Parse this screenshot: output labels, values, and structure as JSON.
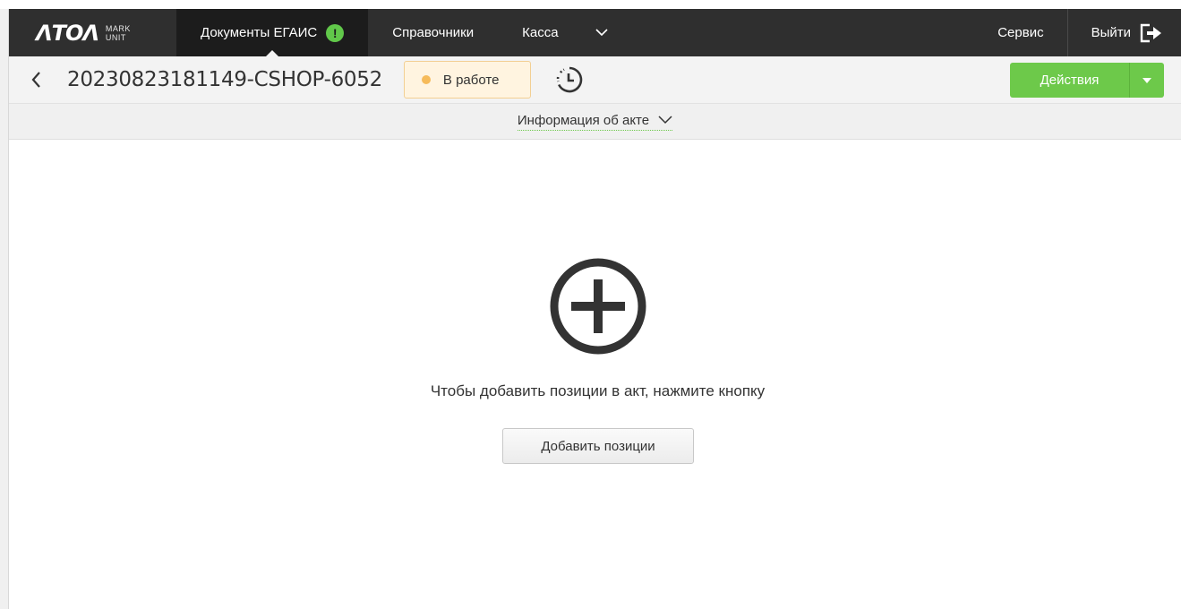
{
  "nav": {
    "logo_word": "ΛTOΛ",
    "logo_sub_top": "MARK",
    "logo_sub_bottom": "UNIT",
    "items": [
      {
        "label": "Документы ЕГАИС",
        "active": true,
        "badge": "!"
      },
      {
        "label": "Справочники"
      },
      {
        "label": "Касса"
      }
    ],
    "service": "Сервис",
    "logout": "Выйти"
  },
  "doc": {
    "title": "20230823181149-CSHOP-6052",
    "status": "В работе",
    "status_color": "#f6bb5a",
    "actions_label": "Действия",
    "actions_color": "#6dc94a"
  },
  "info": {
    "toggle_label": "Информация об акте"
  },
  "empty": {
    "message": "Чтобы добавить позиции в акт, нажмите кнопку",
    "button_label": "Добавить позиции"
  }
}
